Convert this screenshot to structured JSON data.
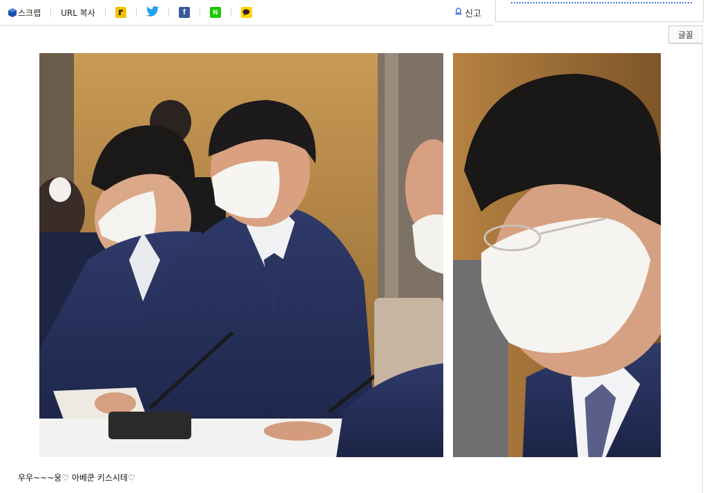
{
  "toolbar": {
    "scrap_label": "스크랩",
    "url_copy_label": "URL 복사",
    "kakaostory_glyph": "",
    "naver_glyph": "N",
    "facebook_glyph": "f",
    "report_label": "신고",
    "icons": [
      "scrap-icon",
      "kakaostory-icon",
      "twitter-icon",
      "facebook-icon",
      "naver-icon",
      "kakaotalk-icon",
      "report-icon"
    ]
  },
  "font_button": {
    "label": "글꼴"
  },
  "post": {
    "caption": "우우~~~웅♡ 아베쿤 키스시테♡"
  },
  "colors": {
    "toolbar_border": "#d7d7d7",
    "twitter": "#1da1f2",
    "facebook": "#3b5998",
    "naver": "#1ec800",
    "kakaotalk": "#ffd400",
    "kakaostory": "#f2c400"
  }
}
